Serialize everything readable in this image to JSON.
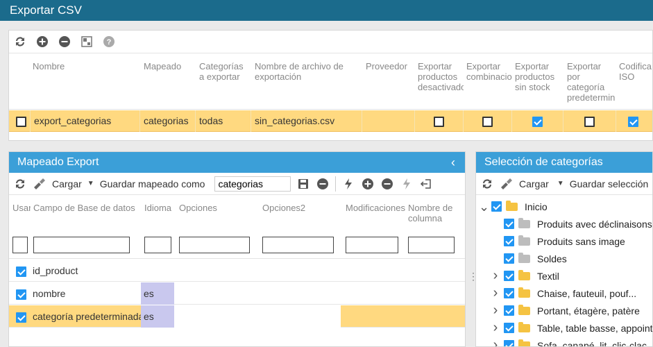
{
  "window": {
    "title": "Exportar CSV"
  },
  "top_toolbar": {
    "icons": [
      "refresh-icon",
      "add-icon",
      "remove-icon",
      "grid-icon",
      "help-icon"
    ]
  },
  "export_table": {
    "columns": [
      "Nombre",
      "Mapeado",
      "Categorías\na exportar",
      "Nombre de archivo de\nexportación",
      "Proveedor",
      "Exportar\nproductos\ndesactivados",
      "Exportar\ncombinaciones",
      "Exportar\nproductos\nsin stock",
      "Exportar\npor\ncategoría\npredeterminada",
      "Codifica\nISO"
    ],
    "rows": [
      {
        "nombre": "export_categorias",
        "mapeado": "categorias",
        "categorias": "todas",
        "archivo": "sin_categorias.csv",
        "proveedor": "",
        "desactivados": false,
        "combinaciones": false,
        "sin_stock": true,
        "por_categoria": false,
        "iso": true
      }
    ]
  },
  "mapping_panel": {
    "title": "Mapeado Export",
    "toolbar": {
      "load_label": "Cargar",
      "save_mapping_label": "Guardar mapeado como",
      "mapping_name_value": "categorias"
    },
    "columns": [
      "Usar",
      "Campo de Base de datos",
      "Idioma",
      "Opciones",
      "Opciones2",
      "Modificaciones",
      "Nombre de\ncolumna"
    ],
    "rows": [
      {
        "checked": true,
        "field": "id_product",
        "lang": ""
      },
      {
        "checked": true,
        "field": "nombre",
        "lang": "es"
      },
      {
        "checked": true,
        "field": "categoría predeterminada",
        "lang": "es"
      }
    ]
  },
  "categories_panel": {
    "title": "Selección de categorías",
    "toolbar": {
      "load_label": "Cargar",
      "save_label": "Guardar selección"
    },
    "tree": [
      {
        "label": "Inicio",
        "level": 0,
        "arrow": "down",
        "folder": "yellow",
        "checked": true
      },
      {
        "label": "Produits avec déclinaisons",
        "level": 1,
        "arrow": "",
        "folder": "gray",
        "checked": true
      },
      {
        "label": "Produits sans image",
        "level": 1,
        "arrow": "",
        "folder": "gray",
        "checked": true
      },
      {
        "label": "Soldes",
        "level": 1,
        "arrow": "",
        "folder": "gray",
        "checked": true
      },
      {
        "label": "Textil",
        "level": 1,
        "arrow": "right",
        "folder": "yellow",
        "checked": true
      },
      {
        "label": "Chaise, fauteuil, pouf...",
        "level": 1,
        "arrow": "right",
        "folder": "yellow",
        "checked": true
      },
      {
        "label": "Portant, étagère, patère",
        "level": 1,
        "arrow": "right",
        "folder": "yellow",
        "checked": true
      },
      {
        "label": "Table, table basse, appoint",
        "level": 1,
        "arrow": "right",
        "folder": "yellow",
        "checked": true
      },
      {
        "label": "Sofa, canapé, lit, clic-clac",
        "level": 1,
        "arrow": "right",
        "folder": "yellow",
        "checked": true
      }
    ]
  },
  "colors": {
    "titlebar": "#1b6b8c",
    "panel_header": "#3b9fd8",
    "selected_row": "#ffd980",
    "language_cell": "#c9c8ee",
    "checkbox": "#2196f3"
  }
}
